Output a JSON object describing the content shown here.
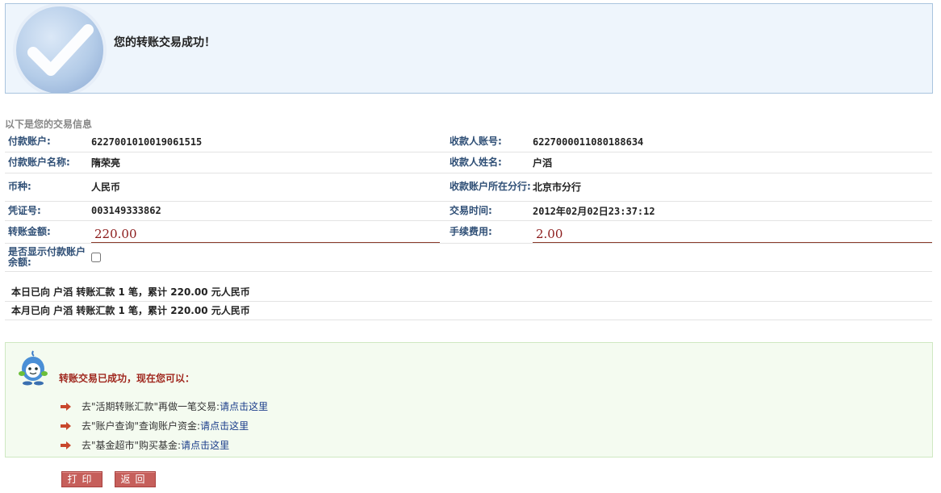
{
  "success": {
    "icon": "checkmark-icon",
    "title": "您的转账交易成功！"
  },
  "section_title": "以下是您的交易信息",
  "info": {
    "payer_account_label": "付款账户:",
    "payer_account": "6227001010019061515",
    "payee_account_label": "收款人账号:",
    "payee_account": "6227000011080188634",
    "payer_name_label": "付款账户名称:",
    "payer_name": "隋荣亮",
    "payee_name_label": "收款人姓名:",
    "payee_name": "户滔",
    "currency_label": "币种:",
    "currency": "人民币",
    "payee_branch_label": "收款账户所在分行:",
    "payee_branch": "北京市分行",
    "voucher_label": "凭证号:",
    "voucher": "003149333862",
    "time_label": "交易时间:",
    "time": "2012年02月02日23:37:12",
    "amount_label": "转账金额:",
    "amount": "220.00",
    "fee_label": "手续费用:",
    "fee": "2.00",
    "show_balance_label": "是否显示付款账户余额:",
    "show_balance_checked": false
  },
  "summary": {
    "today": "本日已向 户滔 转账汇款 1 笔，累计 220.00 元人民币",
    "month": "本月已向 户滔 转账汇款 1 笔，累计 220.00 元人民币"
  },
  "next_steps": {
    "icon": "mascot-icon",
    "title": "转账交易已成功，现在您可以：",
    "items": [
      {
        "text": "去\"活期转账汇款\"再做一笔交易:",
        "link": "请点击这里"
      },
      {
        "text": "去\"账户查询\"查询账户资金:",
        "link": "请点击这里"
      },
      {
        "text": "去\"基金超市\"购买基金:",
        "link": "请点击这里"
      }
    ]
  },
  "buttons": {
    "print": "打印",
    "back": "返回"
  },
  "colors": {
    "accent_red": "#8b1a1a",
    "button_bg": "#c65f5b",
    "link_blue": "#1a3c8a"
  }
}
